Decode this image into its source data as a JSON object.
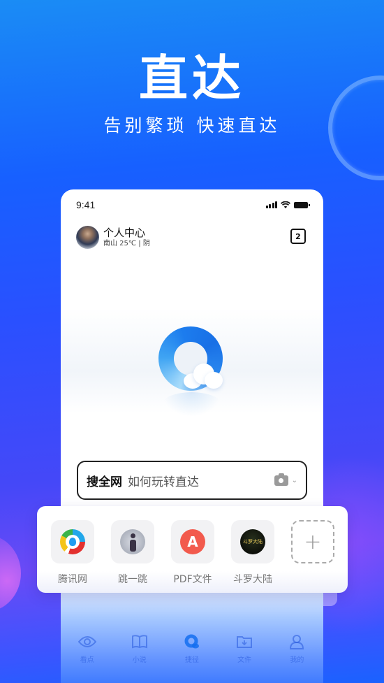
{
  "promo": {
    "headline": "直达",
    "subline": "告别繁琐 快速直达"
  },
  "phone": {
    "status_bar": {
      "time": "9:41"
    },
    "profile": {
      "name": "个人中心",
      "weather": "南山 25℃ | 阴"
    },
    "tab_count": "2",
    "search": {
      "scope": "搜全网",
      "query": "如何玩转直达"
    },
    "bottom_nav": [
      {
        "label": "看点",
        "icon": "eye-icon"
      },
      {
        "label": "小说",
        "icon": "book-icon"
      },
      {
        "label": "捷径",
        "icon": "qq-browser-icon",
        "active": true
      },
      {
        "label": "文件",
        "icon": "folder-download-icon"
      },
      {
        "label": "我的",
        "icon": "user-icon"
      }
    ]
  },
  "shortcuts": [
    {
      "label": "腾讯网",
      "icon": "tencent-news-icon"
    },
    {
      "label": "跳一跳",
      "icon": "jump-game-icon"
    },
    {
      "label": "PDF文件",
      "icon": "pdf-icon",
      "glyph": "A"
    },
    {
      "label": "斗罗大陆",
      "icon": "douluo-icon",
      "glyph": "斗罗大陆"
    },
    {
      "label": "",
      "icon": "add-icon",
      "glyph": "+"
    }
  ],
  "colors": {
    "brand_blue": "#1760ff",
    "pdf_red": "#f25a4d",
    "logo_blue": "#1c7cee"
  }
}
